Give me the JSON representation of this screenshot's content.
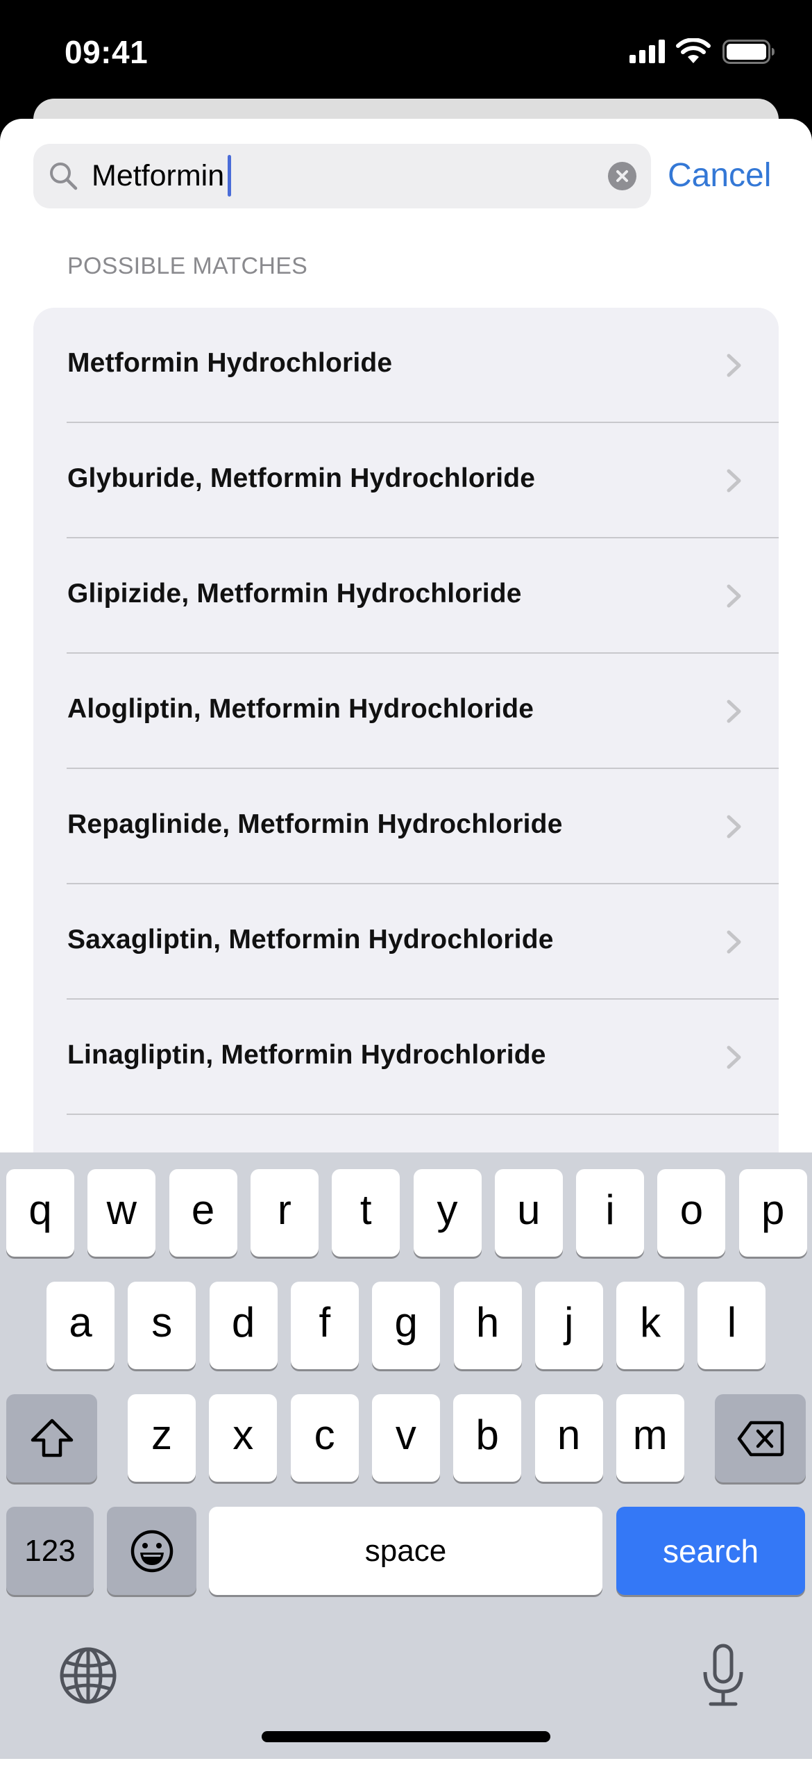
{
  "status_bar": {
    "time": "09:41"
  },
  "search": {
    "value": "Metformin",
    "cancel_label": "Cancel"
  },
  "results": {
    "section_header": "POSSIBLE MATCHES",
    "items": [
      {
        "label": "Metformin Hydrochloride"
      },
      {
        "label": "Glyburide, Metformin Hydrochloride"
      },
      {
        "label": "Glipizide, Metformin Hydrochloride"
      },
      {
        "label": "Alogliptin, Metformin Hydrochloride"
      },
      {
        "label": "Repaglinide, Metformin Hydrochloride"
      },
      {
        "label": "Saxagliptin, Metformin Hydrochloride"
      },
      {
        "label": "Linagliptin, Metformin Hydrochloride"
      }
    ]
  },
  "keyboard": {
    "row1": [
      "q",
      "w",
      "e",
      "r",
      "t",
      "y",
      "u",
      "i",
      "o",
      "p"
    ],
    "row2": [
      "a",
      "s",
      "d",
      "f",
      "g",
      "h",
      "j",
      "k",
      "l"
    ],
    "row3": [
      "z",
      "x",
      "c",
      "v",
      "b",
      "n",
      "m"
    ],
    "numbers_label": "123",
    "space_label": "space",
    "return_label": "search",
    "icons": {
      "shift": "shift-icon",
      "delete": "delete-icon",
      "emoji": "emoji-icon",
      "globe": "globe-icon",
      "mic": "mic-icon"
    }
  },
  "colors": {
    "accent": "#3478f6",
    "cancel_text": "#3478d6",
    "list_background": "#f0f0f5",
    "keyboard_background": "#d0d3da",
    "section_header": "#8a8a8e"
  }
}
